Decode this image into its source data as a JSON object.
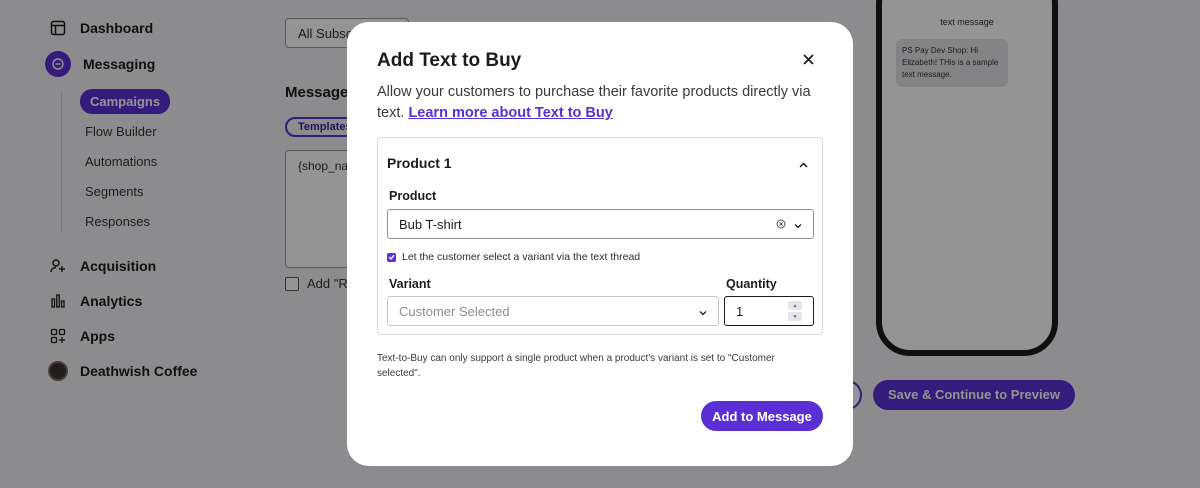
{
  "sidebar": {
    "items": [
      {
        "label": "Dashboard",
        "icon": "dashboard-icon"
      },
      {
        "label": "Messaging",
        "icon": "chat-icon"
      },
      {
        "label": "Acquisition",
        "icon": "users-plus-icon"
      },
      {
        "label": "Analytics",
        "icon": "bar-chart-icon"
      },
      {
        "label": "Apps",
        "icon": "apps-grid-icon"
      },
      {
        "label": "Deathwish Coffee",
        "icon": "store-avatar"
      }
    ],
    "messaging_sub": [
      "Campaigns",
      "Flow Builder",
      "Automations",
      "Segments",
      "Responses"
    ]
  },
  "main": {
    "audience_select": "All Subsc",
    "message_heading": "Message",
    "templates_label": "Templates",
    "message_text": "{shop_na",
    "add_checkbox_label": "Add \"Re",
    "save_continue_label": "Save & Continue to Preview"
  },
  "phone": {
    "title": "text message",
    "bubble": "PS Pay Dev Shop: Hi Elizabeth! THis is a sample text message."
  },
  "modal": {
    "title": "Add Text to Buy",
    "description": "Allow your customers to purchase their favorite products directly via text.",
    "learn_more": "Learn more about Text to Buy",
    "product_section_title": "Product 1",
    "product_label": "Product",
    "product_value": "Bub T-shirt",
    "variant_checkbox_label": "Let the customer select a variant via the text thread",
    "variant_checkbox_checked": true,
    "variant_label": "Variant",
    "variant_placeholder": "Customer Selected",
    "quantity_label": "Quantity",
    "quantity_value": "1",
    "footnote": "Text-to-Buy can only support a single product when a product's variant is set to \"Customer selected\".",
    "add_button": "Add to Message"
  },
  "colors": {
    "accent": "#5a2fd6"
  }
}
